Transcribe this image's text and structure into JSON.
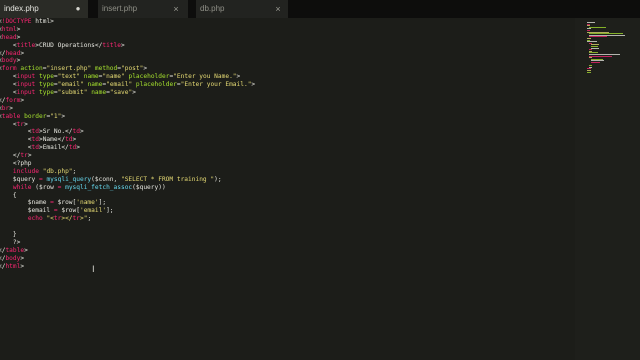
{
  "tabs": [
    {
      "label": "index.php",
      "active": true,
      "indicator": "●"
    },
    {
      "label": "insert.php",
      "active": false,
      "close": "×"
    },
    {
      "label": "db.php",
      "active": false,
      "close": "×"
    }
  ],
  "code_lines": [
    "<!DOCTYPE html>",
    "<html>",
    "<head>",
    "    <title>CRUD Operations</title>",
    "</head>",
    "<body>",
    "<form action=\"insert.php\" method=\"post\">",
    "    <input type=\"text\" name=\"name\" placeholder=\"Enter you Name.\">",
    "    <input type=\"email\" name=\"email\" placeholder=\"Enter your Email.\">",
    "    <input type=\"submit\" name=\"save\">",
    "</form>",
    "<br>",
    "<table border=\"1\">",
    "    <tr>",
    "        <td>Sr No.</td>",
    "        <td>Name</td>",
    "        <td>Email</td>",
    "    </tr>",
    "    <?php",
    "    include \"db.php\";",
    "    $query = mysqli_query($conn, \"SELECT * FROM training \");",
    "    while ($row = mysqli_fetch_assoc($query))",
    "    {",
    "        $name = $row['name'];",
    "        $email = $row['email'];",
    "        echo \"<tr></tr>\";",
    "",
    "    }",
    "    ?>",
    "</table>",
    "</body>",
    "</html>"
  ],
  "colors": {
    "background": "#1c1d19",
    "tag": "#f92672",
    "attribute": "#a6e22e",
    "string": "#e6db74",
    "function": "#66d9ef",
    "text": "#e7e7e0"
  },
  "cursor_icon": "text-cursor-icon"
}
